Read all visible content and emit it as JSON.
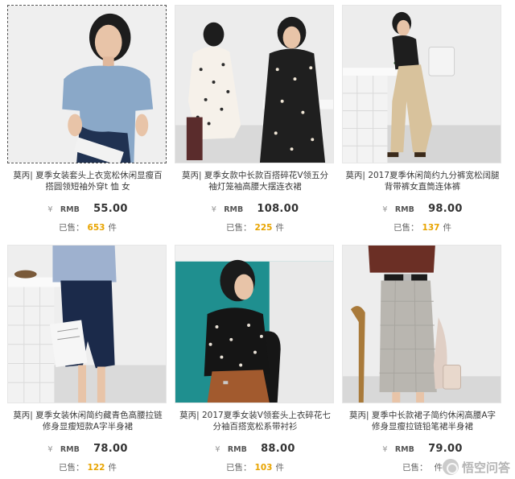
{
  "products": [
    {
      "title": "莫丙| 夏季女装套头上衣宽松休闲显瘦百搭圆领短袖外穿t 恤 女",
      "yen": "¥",
      "currency": "RMB",
      "price": "55.00",
      "sold_label": "已售：",
      "sold_count": "653",
      "unit": "件"
    },
    {
      "title": "莫丙| 夏季女款中长款百搭碎花V领五分袖灯笼袖高腰大摆连衣裙",
      "yen": "¥",
      "currency": "RMB",
      "price": "108.00",
      "sold_label": "已售：",
      "sold_count": "225",
      "unit": "件"
    },
    {
      "title": "莫丙| 2017夏季休闲简约九分裤宽松阔腿背带裤女直筒连体裤",
      "yen": "¥",
      "currency": "RMB",
      "price": "98.00",
      "sold_label": "已售：",
      "sold_count": "137",
      "unit": "件"
    },
    {
      "title": "莫丙| 夏季女装休闲简约藏青色高腰拉链修身显瘦短款A字半身裙",
      "yen": "¥",
      "currency": "RMB",
      "price": "78.00",
      "sold_label": "已售：",
      "sold_count": "122",
      "unit": "件"
    },
    {
      "title": "莫丙| 2017夏季女装V领套头上衣碎花七分袖百搭宽松系带衬衫",
      "yen": "¥",
      "currency": "RMB",
      "price": "88.00",
      "sold_label": "已售：",
      "sold_count": "103",
      "unit": "件"
    },
    {
      "title": "莫丙| 夏季中长款裙子简约休闲高腰A字修身显瘦拉链铅笔裙半身裙",
      "yen": "¥",
      "currency": "RMB",
      "price": "79.00",
      "sold_label": "已售：",
      "sold_count": "",
      "unit": "件"
    }
  ],
  "watermark": {
    "text": "悟空问答"
  }
}
